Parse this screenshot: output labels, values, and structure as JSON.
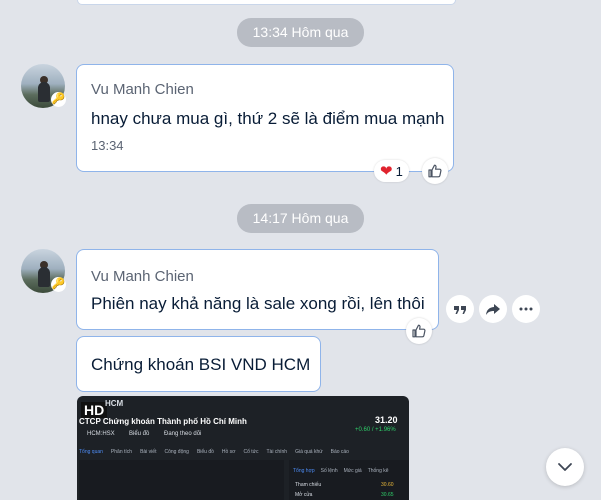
{
  "messages": [
    {
      "time_divider": "13:34 Hôm qua",
      "sender": "Vu Manh Chien",
      "text": "hnay chưa mua gì, thứ 2 sẽ là điểm mua mạnh",
      "timestamp": "13:34",
      "reaction_count": "1"
    },
    {
      "time_divider": "14:17 Hôm qua",
      "sender": "Vu Manh Chien",
      "text": "Phiên nay khả năng là sale xong rồi, lên thôi",
      "followup_text": "Chứng khoán BSI VND HCM"
    }
  ],
  "attachment": {
    "badge": "HD",
    "ticker": "HCM",
    "company": "CTCP Chứng khoán Thành phố Hồ Chí Minh",
    "exchange": "HCM:HSX",
    "price": "31.20",
    "change": "+0.60 / +1.96%",
    "tabs": [
      "Tổng quan",
      "Phân tích",
      "Bài viết",
      "Công động",
      "Biểu đồ",
      "Hồ sơ",
      "Cổ tức",
      "Tài chính",
      "Giá quá khứ",
      "Báo cáo"
    ],
    "follow_label": "Đang theo dõi",
    "chart_label": "Biểu đồ",
    "side_tabs": [
      "Tổng hợp",
      "Số lệnh",
      "Mức giá",
      "Thống kê"
    ],
    "ref_label": "Tham chiếu",
    "ref_value": "30.60",
    "ceiling_label": "Mở cửa",
    "ceiling_value": "30.65"
  },
  "colors": {
    "background": "#e1e4ea",
    "bubble_border": "#8fb4ea",
    "time_pill": "#b8bcc4"
  },
  "icons": {
    "like": "thumbs-up-icon",
    "heart": "heart-icon",
    "quote": "quote-icon",
    "share": "share-icon",
    "more": "more-icon",
    "scroll_down": "chevron-down-icon"
  }
}
